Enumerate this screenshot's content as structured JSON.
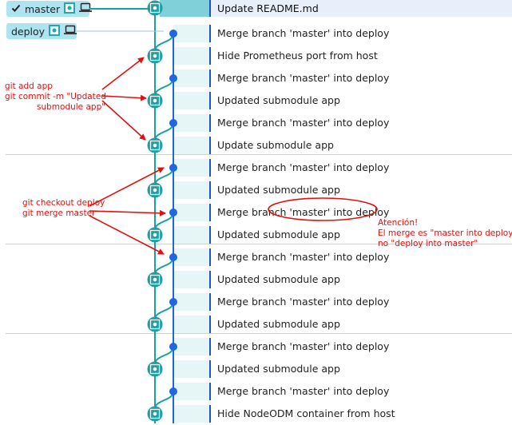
{
  "branch_labels": [
    {
      "name": "master",
      "checked": true
    },
    {
      "name": "deploy",
      "checked": false
    }
  ],
  "commits": [
    {
      "message": "Update README.md",
      "lane": 0,
      "type": "head"
    },
    {
      "message": "Merge branch 'master' into deploy",
      "lane": 1,
      "type": "merge"
    },
    {
      "message": "Hide Prometheus port from host",
      "lane": 0,
      "type": "commit"
    },
    {
      "message": "Merge branch 'master' into deploy",
      "lane": 1,
      "type": "merge"
    },
    {
      "message": "Updated submodule app",
      "lane": 0,
      "type": "commit"
    },
    {
      "message": "Merge branch 'master' into deploy",
      "lane": 1,
      "type": "merge"
    },
    {
      "message": "Update submodule app",
      "lane": 0,
      "type": "commit"
    },
    {
      "message": "Merge branch 'master' into deploy",
      "lane": 1,
      "type": "merge"
    },
    {
      "message": "Updated submodule app",
      "lane": 0,
      "type": "commit"
    },
    {
      "message": "Merge branch 'master' into deploy",
      "lane": 1,
      "type": "merge"
    },
    {
      "message": "Updated submodule app",
      "lane": 0,
      "type": "commit"
    },
    {
      "message": "Merge branch 'master' into deploy",
      "lane": 1,
      "type": "merge"
    },
    {
      "message": "Updated submodule app",
      "lane": 0,
      "type": "commit"
    },
    {
      "message": "Merge branch 'master' into deploy",
      "lane": 1,
      "type": "merge"
    },
    {
      "message": "Updated submodule app",
      "lane": 0,
      "type": "commit"
    },
    {
      "message": "Merge branch 'master' into deploy",
      "lane": 1,
      "type": "merge"
    },
    {
      "message": "Updated submodule app",
      "lane": 0,
      "type": "commit"
    },
    {
      "message": "Merge branch 'master' into deploy",
      "lane": 1,
      "type": "merge"
    },
    {
      "message": "Hide NodeODM container from host",
      "lane": 0,
      "type": "commit"
    }
  ],
  "annotations": {
    "note1": [
      "git add app",
      "git commit -m \"Updated",
      "submodule app\""
    ],
    "note2": [
      "git checkout deploy",
      "git merge master"
    ],
    "note3": [
      "Atención!",
      "El merge es \"master into deploy\",",
      "no \"deploy into master\""
    ]
  },
  "colors": {
    "graph_line": "#1a9fa4",
    "merge_dot": "#1f66e0",
    "commit_node": "#1a9fa4",
    "annotation": "#e01010",
    "head_row": "#7fd0d8"
  }
}
